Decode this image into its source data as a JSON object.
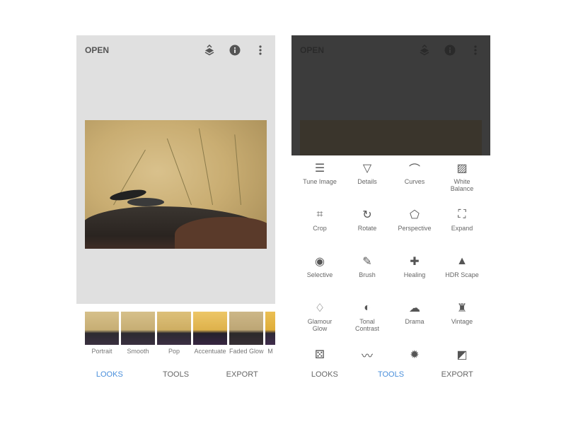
{
  "left": {
    "header": {
      "open_label": "OPEN",
      "icons": [
        "layers-icon",
        "info-icon",
        "more-vert-icon"
      ]
    },
    "looks": [
      "Portrait",
      "Smooth",
      "Pop",
      "Accentuate",
      "Faded Glow",
      "M"
    ],
    "nav": {
      "looks": "LOOKS",
      "tools": "TOOLS",
      "export": "EXPORT",
      "active": "LOOKS"
    }
  },
  "right": {
    "header": {
      "open_label": "OPEN",
      "icons": [
        "layers-icon",
        "info-icon",
        "more-vert-icon"
      ]
    },
    "tools": [
      {
        "label": "Tune Image",
        "icon": "sliders-icon"
      },
      {
        "label": "Details",
        "icon": "triangle-icon"
      },
      {
        "label": "Curves",
        "icon": "curves-icon"
      },
      {
        "label": "White\nBalance",
        "icon": "white-balance-icon"
      },
      {
        "label": "Crop",
        "icon": "crop-icon"
      },
      {
        "label": "Rotate",
        "icon": "rotate-icon"
      },
      {
        "label": "Perspective",
        "icon": "perspective-icon"
      },
      {
        "label": "Expand",
        "icon": "expand-icon"
      },
      {
        "label": "Selective",
        "icon": "selective-icon"
      },
      {
        "label": "Brush",
        "icon": "brush-icon"
      },
      {
        "label": "Healing",
        "icon": "healing-icon"
      },
      {
        "label": "HDR Scape",
        "icon": "mountain-icon"
      },
      {
        "label": "Glamour\nGlow",
        "icon": "diamond-icon"
      },
      {
        "label": "Tonal\nContrast",
        "icon": "tonal-icon"
      },
      {
        "label": "Drama",
        "icon": "cloud-icon"
      },
      {
        "label": "Vintage",
        "icon": "lamp-icon"
      },
      {
        "label": "",
        "icon": "grainy-icon"
      },
      {
        "label": "",
        "icon": "mustache-icon"
      },
      {
        "label": "",
        "icon": "grunge-icon"
      },
      {
        "label": "",
        "icon": "bw-icon"
      }
    ],
    "nav": {
      "looks": "LOOKS",
      "tools": "TOOLS",
      "export": "EXPORT",
      "active": "TOOLS"
    }
  },
  "colors": {
    "accent": "#4a8fdb",
    "stage": "#e0e0e0",
    "overlay": "#3c3c3c"
  }
}
